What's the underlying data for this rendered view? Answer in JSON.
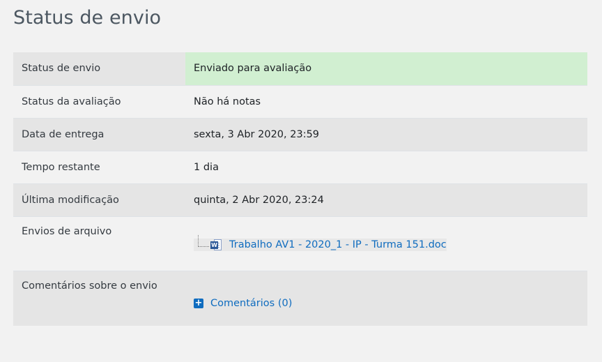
{
  "page_title": "Status de envio",
  "rows": [
    {
      "label": "Status de envio",
      "value": "Enviado para avaliação",
      "value_color": "#d1efd1"
    },
    {
      "label": "Status da avaliação",
      "value": "Não há notas"
    },
    {
      "label": "Data de entrega",
      "value": "sexta, 3 Abr 2020, 23:59"
    },
    {
      "label": "Tempo restante",
      "value": "1 dia"
    },
    {
      "label": "Última modificação",
      "value": "quinta, 2 Abr 2020, 23:24"
    },
    {
      "label": "Envios de arquivo",
      "file": {
        "name": "Trabalho AV1 - 2020_1 - IP - Turma 151.doc",
        "icon": "word-document-icon"
      }
    },
    {
      "label": "Comentários sobre o envio",
      "comments": {
        "label": "Comentários (0)",
        "icon": "plus-square-icon"
      }
    }
  ],
  "colors": {
    "link": "#0f6cbf",
    "submitted_bg": "#d1efd1",
    "stripe_bg": "#e5e5e5",
    "page_bg": "#f2f2f2"
  }
}
